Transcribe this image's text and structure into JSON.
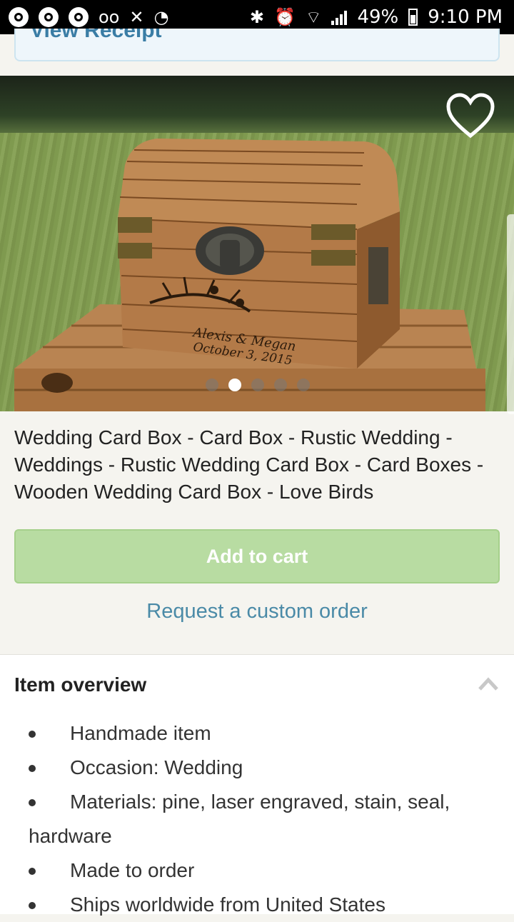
{
  "status_bar": {
    "battery": "49%",
    "time": "9:10 PM"
  },
  "receipt_link": "View Receipt",
  "product": {
    "title": "Wedding Card Box - Card Box - Rustic Wedding - Weddings - Rustic Wedding Card Box - Card Boxes - Wooden Wedding Card Box - Love Birds",
    "image_text": {
      "line1": "Alexis & Megan",
      "line2": "October 3, 2015"
    },
    "carousel": {
      "count": 5,
      "active_index": 1
    }
  },
  "actions": {
    "add_to_cart": "Add to cart",
    "custom_order": "Request a custom order"
  },
  "overview": {
    "title": "Item overview",
    "items": [
      "Handmade item",
      "Occasion: Wedding",
      "Materials: pine, laser engraved, stain, seal, hardware",
      "Made to order",
      "Ships worldwide from United States"
    ]
  },
  "colors": {
    "add_button": "#b8dca2",
    "link": "#4a8aa7",
    "statusbar": "#000000"
  }
}
